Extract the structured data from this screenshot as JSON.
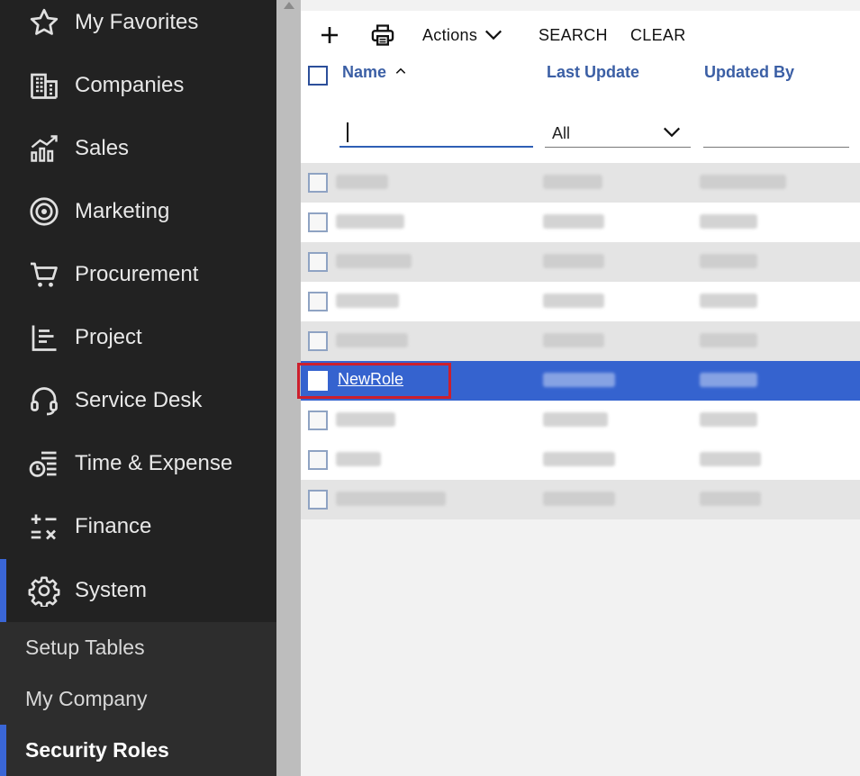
{
  "sidebar": {
    "items": [
      {
        "label": "My Favorites",
        "icon": "star-icon"
      },
      {
        "label": "Companies",
        "icon": "building-icon"
      },
      {
        "label": "Sales",
        "icon": "chart-icon"
      },
      {
        "label": "Marketing",
        "icon": "target-icon"
      },
      {
        "label": "Procurement",
        "icon": "cart-icon"
      },
      {
        "label": "Project",
        "icon": "project-icon"
      },
      {
        "label": "Service Desk",
        "icon": "headset-icon"
      },
      {
        "label": "Time & Expense",
        "icon": "time-expense-icon"
      },
      {
        "label": "Finance",
        "icon": "finance-icon"
      },
      {
        "label": "System",
        "icon": "gear-icon"
      }
    ],
    "sub_items": [
      {
        "label": "Setup Tables"
      },
      {
        "label": "My Company"
      },
      {
        "label": "Security Roles"
      }
    ],
    "accent_color": "#3a66d6"
  },
  "toolbar": {
    "add_icon": "plus-icon",
    "print_icon": "printer-icon",
    "actions_label": "Actions",
    "search_label": "SEARCH",
    "clear_label": "CLEAR"
  },
  "table": {
    "columns": {
      "name": "Name",
      "last_update": "Last Update",
      "updated_by": "Updated By"
    },
    "filter": {
      "update_select_value": "All"
    },
    "selected_row": {
      "name": "NewRole"
    },
    "selection_color": "#3563cf",
    "highlight_color": "#cc1f2d"
  }
}
